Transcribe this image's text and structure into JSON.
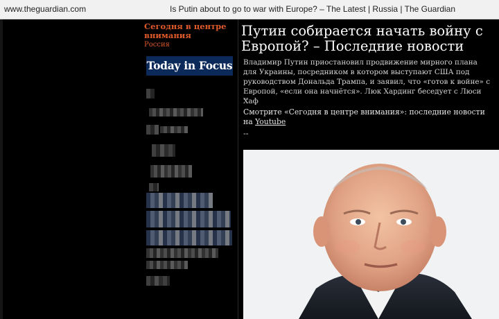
{
  "browser": {
    "domain": "www.theguardian.com",
    "tab_title": "Is Putin about to go to war with Europe? – The Latest | Russia | The Guardian"
  },
  "sidebar": {
    "series_title": "Сегодня в центре внимания",
    "section": "Россия",
    "logo_text": "Today in Focus"
  },
  "article": {
    "headline": "Путин собирается начать войну с Европой? – Последние новости",
    "standfirst": "Владимир Путин приостановил продвижение мирного плана для Украины, посредником в котором выступают США под руководством Дональда Трампа, и заявил, что «готов к войне» с Европой, «если она начнётся». Люк Хардинг беседует с Люси Хаф",
    "separator": "--",
    "watch_prefix": "Смотрите «Сегодня в центре внимания»: последние новости на ",
    "watch_link": "Youtube",
    "separator2": "--"
  },
  "colors": {
    "accent": "#e05a2a",
    "logo_bg": "#0b2a5a",
    "background": "#000000"
  }
}
